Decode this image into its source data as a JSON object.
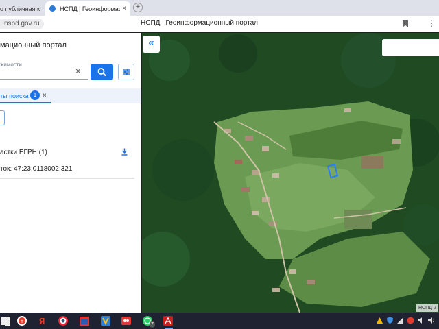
{
  "browser": {
    "tabs": [
      {
        "label": "о публичная ка",
        "active": false
      },
      {
        "label": "НСПД | Геоинформаци",
        "active": true
      }
    ],
    "tab_close": "×",
    "new_tab": "+",
    "url": "nspd.gov.ru",
    "page_title": "НСПД | Геоинформационный портал",
    "menu": "⋮"
  },
  "sidebar": {
    "portal_title": "мационный портал",
    "search_hint": "жимости",
    "clear": "×",
    "results_tab": {
      "label": "ты поиска",
      "count": "1",
      "close": "×"
    },
    "group_label": "астки ЕГРН (1)",
    "parcel": "ток: 47:23:0118002:321"
  },
  "map": {
    "collapse": "«",
    "attribution": "НСПД 2"
  },
  "colors": {
    "accent": "#1a73e8",
    "forest": "#1f4a22",
    "field": "#6b9a52"
  },
  "taskbar": {
    "whatsapp_badge": "7"
  }
}
